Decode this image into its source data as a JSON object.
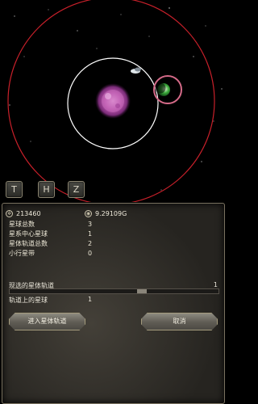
{
  "hotkeys": [
    "T",
    "H",
    "Z"
  ],
  "resources": {
    "crystals": "213460",
    "gold": "9.29109G"
  },
  "stats": [
    {
      "label": "星球总数",
      "value": "3"
    },
    {
      "label": "星系中心星球",
      "value": "1"
    },
    {
      "label": "星体轨道总数",
      "value": "2"
    },
    {
      "label": "小行星带",
      "value": "0"
    }
  ],
  "selected_orbit": {
    "label": "现选的星体轨道",
    "value": "1",
    "slider_fraction": 0.64
  },
  "planets_on_orbit": {
    "label": "轨道上的星球",
    "value": "1"
  },
  "buttons": {
    "enter": "进入星体轨道",
    "cancel": "取消"
  },
  "colors": {
    "outer_orbit": "#c8202a",
    "inner_orbit": "#ffffff",
    "selection_ring": "#d46a88",
    "star": "#c05ab0"
  }
}
